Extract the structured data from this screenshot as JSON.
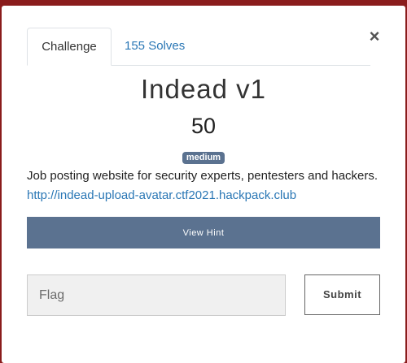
{
  "tabs": {
    "challenge_label": "Challenge",
    "solves_label": "155 Solves"
  },
  "close_glyph": "×",
  "challenge": {
    "name": "Indead v1",
    "value": "50",
    "tag": "medium",
    "description_text": "Job posting website for security experts, pentesters and hackers. ",
    "description_link": "http://indead-upload-avatar.ctf2021.hackpack.club"
  },
  "hint_button_label": "View Hint",
  "flag_input": {
    "placeholder": "Flag",
    "value": ""
  },
  "submit_label": "Submit",
  "colors": {
    "accent": "#5b7290",
    "link": "#2a77b5",
    "backdrop": "#8a1c1c"
  },
  "icons": {
    "close": "close-icon"
  }
}
